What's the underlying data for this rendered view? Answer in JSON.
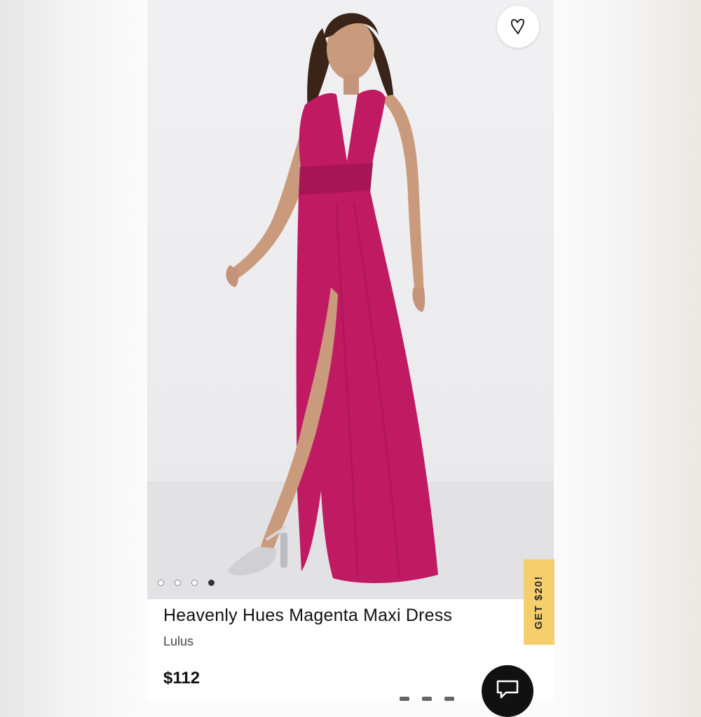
{
  "product": {
    "title": "Heavenly Hues Magenta Maxi Dress",
    "brand": "Lulus",
    "price": "$112",
    "dress_color": "#c01a63"
  },
  "gallery": {
    "image_count": 4,
    "active_index": 3
  },
  "promo": {
    "label": "GET $20!",
    "color": "#f6cf6c"
  },
  "icons": {
    "favorite": "heart-icon",
    "chat": "chat-bubble-icon"
  }
}
